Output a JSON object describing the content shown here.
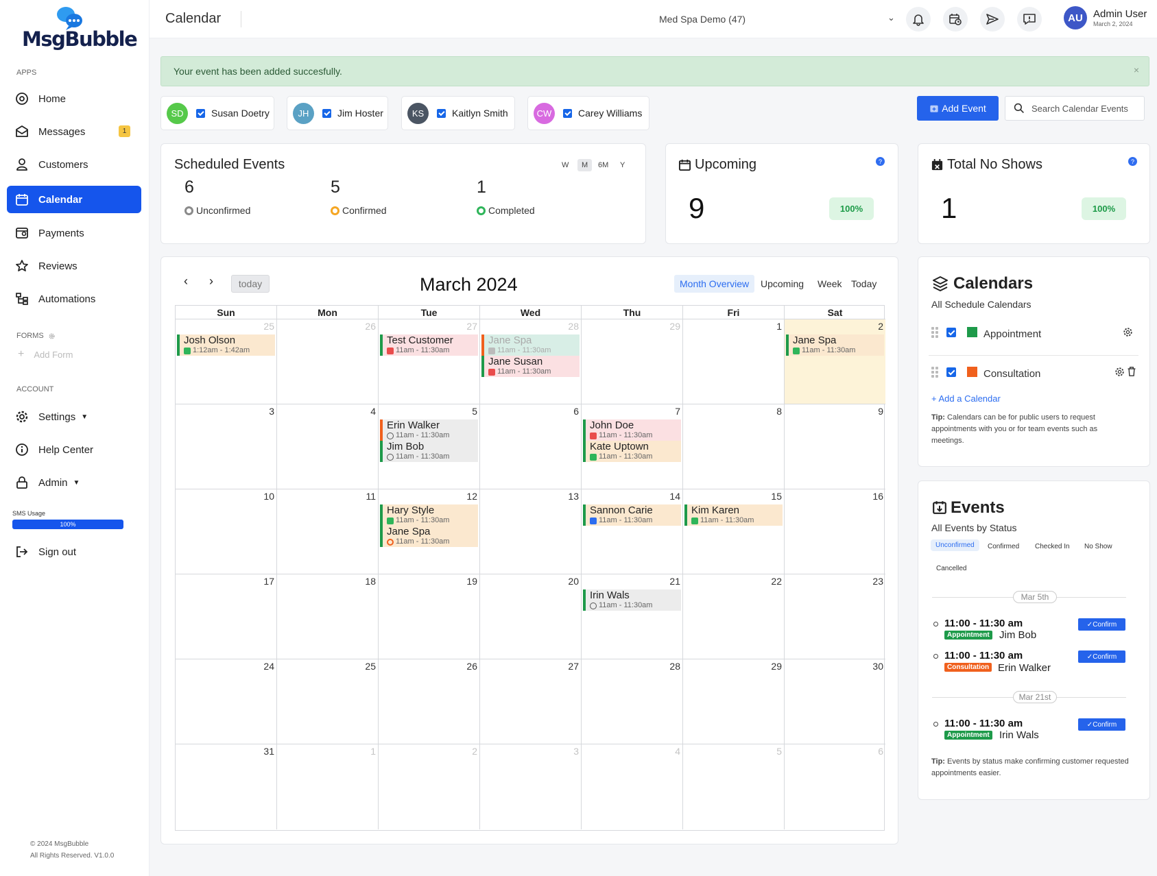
{
  "brand": {
    "name": "MsgBubble"
  },
  "sidebar": {
    "apps_label": "APPS",
    "items": [
      {
        "label": "Home",
        "icon": "target-icon"
      },
      {
        "label": "Messages",
        "icon": "envelope-icon",
        "badge": "1"
      },
      {
        "label": "Customers",
        "icon": "user-icon"
      },
      {
        "label": "Calendar",
        "icon": "calendar-icon",
        "active": true
      },
      {
        "label": "Payments",
        "icon": "payment-icon"
      },
      {
        "label": "Reviews",
        "icon": "star-icon"
      },
      {
        "label": "Automations",
        "icon": "flow-icon"
      }
    ],
    "forms_label": "FORMS",
    "add_form": "Add Form",
    "account_label": "ACCOUNT",
    "account_items": [
      {
        "label": "Settings",
        "icon": "gear-icon"
      },
      {
        "label": "Help Center",
        "icon": "info-icon"
      },
      {
        "label": "Admin",
        "icon": "lock-icon"
      }
    ],
    "sms_usage_label": "SMS Usage",
    "sms_usage_value": "100%",
    "sms_usage_fraction": 1.0,
    "sign_out": "Sign out",
    "footer_copyright": "© 2024 MsgBubble",
    "footer_rights": "All Rights Reserved. V1.0.0"
  },
  "header": {
    "title": "Calendar",
    "account": "Med Spa Demo (47)",
    "user_initials": "AU",
    "user_name": "Admin User",
    "user_date": "March 2, 2024"
  },
  "alert": {
    "message": "Your event has been added succesfully.",
    "close": "×"
  },
  "staff": [
    {
      "initials": "SD",
      "name": "Susan Doetry",
      "color": "#56c94a"
    },
    {
      "initials": "JH",
      "name": "Jim Hoster",
      "color": "#5aa1c4"
    },
    {
      "initials": "KS",
      "name": "Kaitlyn Smith",
      "color": "#4b5563"
    },
    {
      "initials": "CW",
      "name": "Carey Williams",
      "color": "#d86ae0"
    }
  ],
  "actions": {
    "add_event": "Add Event",
    "search_placeholder": "Search Calendar Events"
  },
  "scheduled": {
    "title": "Scheduled Events",
    "ranges": [
      "W",
      "M",
      "6M",
      "Y"
    ],
    "active_range": "M",
    "stats": [
      {
        "count": "6",
        "label": "Unconfirmed",
        "color": "#8a8a8a"
      },
      {
        "count": "5",
        "label": "Confirmed",
        "color": "#f5a623"
      },
      {
        "count": "1",
        "label": "Completed",
        "color": "#2fb55a"
      }
    ]
  },
  "upcoming": {
    "title": "Upcoming",
    "value": "9",
    "pct": "100%"
  },
  "noshows": {
    "title": "Total No Shows",
    "value": "1",
    "pct": "100%"
  },
  "calendar": {
    "month_title": "March 2024",
    "today_label": "today",
    "views": [
      "Month Overview",
      "Upcoming",
      "Week",
      "Today"
    ],
    "active_view": "Month Overview",
    "weekdays": [
      "Sun",
      "Mon",
      "Tue",
      "Wed",
      "Thu",
      "Fri",
      "Sat"
    ],
    "weeks": [
      [
        {
          "d": "25",
          "o": true
        },
        {
          "d": "26",
          "o": true
        },
        {
          "d": "27",
          "o": true
        },
        {
          "d": "28",
          "o": true
        },
        {
          "d": "29",
          "o": true
        },
        {
          "d": "1"
        },
        {
          "d": "2",
          "today": true
        }
      ],
      [
        {
          "d": "3"
        },
        {
          "d": "4"
        },
        {
          "d": "5"
        },
        {
          "d": "6"
        },
        {
          "d": "7"
        },
        {
          "d": "8"
        },
        {
          "d": "9"
        }
      ],
      [
        {
          "d": "10"
        },
        {
          "d": "11"
        },
        {
          "d": "12"
        },
        {
          "d": "13"
        },
        {
          "d": "14"
        },
        {
          "d": "15"
        },
        {
          "d": "16"
        }
      ],
      [
        {
          "d": "17"
        },
        {
          "d": "18"
        },
        {
          "d": "19"
        },
        {
          "d": "20"
        },
        {
          "d": "21"
        },
        {
          "d": "22"
        },
        {
          "d": "23"
        }
      ],
      [
        {
          "d": "24"
        },
        {
          "d": "25"
        },
        {
          "d": "26"
        },
        {
          "d": "27"
        },
        {
          "d": "28"
        },
        {
          "d": "29"
        },
        {
          "d": "30"
        }
      ],
      [
        {
          "d": "31"
        },
        {
          "d": "1",
          "o": true
        },
        {
          "d": "2",
          "o": true
        },
        {
          "d": "3",
          "o": true
        },
        {
          "d": "4",
          "o": true
        },
        {
          "d": "5",
          "o": true
        },
        {
          "d": "6",
          "o": true
        }
      ]
    ],
    "events": [
      {
        "week": 0,
        "day": 0,
        "slot": 0,
        "name": "Josh Olson",
        "time": "1:12am - 1:42am",
        "bg": "peach",
        "cal": "appointment",
        "status": "confirmed"
      },
      {
        "week": 0,
        "day": 2,
        "slot": 0,
        "name": "Test Customer",
        "time": "11am - 11:30am",
        "bg": "pink",
        "cal": "appointment",
        "status": "walk-in"
      },
      {
        "week": 0,
        "day": 3,
        "slot": 0,
        "name": "Jane Spa",
        "time": "11am - 11:30am",
        "bg": "mint",
        "cal": "consultation",
        "status": "completed",
        "faded": true
      },
      {
        "week": 0,
        "day": 3,
        "slot": 1,
        "name": "Jane Susan",
        "time": "11am - 11:30am",
        "bg": "pink",
        "cal": "appointment",
        "status": "no-show"
      },
      {
        "week": 0,
        "day": 6,
        "slot": 0,
        "name": "Jane Spa",
        "time": "11am - 11:30am",
        "bg": "peach",
        "cal": "appointment",
        "status": "confirmed"
      },
      {
        "week": 1,
        "day": 2,
        "slot": 0,
        "name": "Erin Walker",
        "time": "11am - 11:30am",
        "bg": "gray",
        "cal": "consultation",
        "status": "unconfirmed"
      },
      {
        "week": 1,
        "day": 2,
        "slot": 1,
        "name": "Jim Bob",
        "time": "11am - 11:30am",
        "bg": "gray",
        "cal": "appointment",
        "status": "unconfirmed"
      },
      {
        "week": 1,
        "day": 4,
        "slot": 0,
        "name": "John Doe",
        "time": "11am - 11:30am",
        "bg": "pink",
        "cal": "appointment",
        "status": "no-show"
      },
      {
        "week": 1,
        "day": 4,
        "slot": 1,
        "name": "Kate Uptown",
        "time": "11am - 11:30am",
        "bg": "peach",
        "cal": "appointment",
        "status": "confirmed"
      },
      {
        "week": 2,
        "day": 2,
        "slot": 0,
        "name": "Hary Style",
        "time": "11am - 11:30am",
        "bg": "peach",
        "cal": "appointment",
        "status": "confirmed"
      },
      {
        "week": 2,
        "day": 2,
        "slot": 1,
        "name": "Jane Spa",
        "time": "11am - 11:30am",
        "bg": "peach",
        "cal": "appointment",
        "status": "rescheduled"
      },
      {
        "week": 2,
        "day": 4,
        "slot": 0,
        "name": "Sannon Carie",
        "time": "11am - 11:30am",
        "bg": "peach",
        "cal": "appointment",
        "status": "checked-in"
      },
      {
        "week": 2,
        "day": 5,
        "slot": 0,
        "name": "Kim Karen",
        "time": "11am - 11:30am",
        "bg": "peach",
        "cal": "appointment",
        "status": "confirmed"
      },
      {
        "week": 3,
        "day": 4,
        "slot": 0,
        "name": "Irin Wals",
        "time": "11am - 11:30am",
        "bg": "gray",
        "cal": "appointment",
        "status": "unconfirmed"
      }
    ]
  },
  "calendars_panel": {
    "title": "Calendars",
    "subtitle": "All Schedule Calendars",
    "items": [
      {
        "name": "Appointment",
        "color": "#1e9a4a"
      },
      {
        "name": "Consultation",
        "color": "#f0601d"
      }
    ],
    "add_link": "+ Add a Calendar",
    "tip_bold": "Tip:",
    "tip_text": "Calendars can be for public users to request appointments with you or for team events such as meetings."
  },
  "events_panel": {
    "title": "Events",
    "subtitle": "All Events by Status",
    "tabs": [
      "Unconfirmed",
      "Confirmed",
      "Checked In",
      "No Show",
      "Cancelled"
    ],
    "active_tab": "Unconfirmed",
    "groups": [
      {
        "date": "Mar 5th",
        "items": [
          {
            "time": "11:00 - 11:30 am",
            "tag": "Appointment",
            "tag_color": "#1e9a4a",
            "name": "Jim Bob",
            "action": "Confirm"
          },
          {
            "time": "11:00 - 11:30 am",
            "tag": "Consultation",
            "tag_color": "#f0601d",
            "name": "Erin Walker",
            "action": "Confirm"
          }
        ]
      },
      {
        "date": "Mar 21st",
        "items": [
          {
            "time": "11:00 - 11:30 am",
            "tag": "Appointment",
            "tag_color": "#1e9a4a",
            "name": "Irin Wals",
            "action": "Confirm"
          }
        ]
      }
    ],
    "tip_bold": "Tip:",
    "tip_text": "Events by status make confirming customer requested appointments easier."
  }
}
